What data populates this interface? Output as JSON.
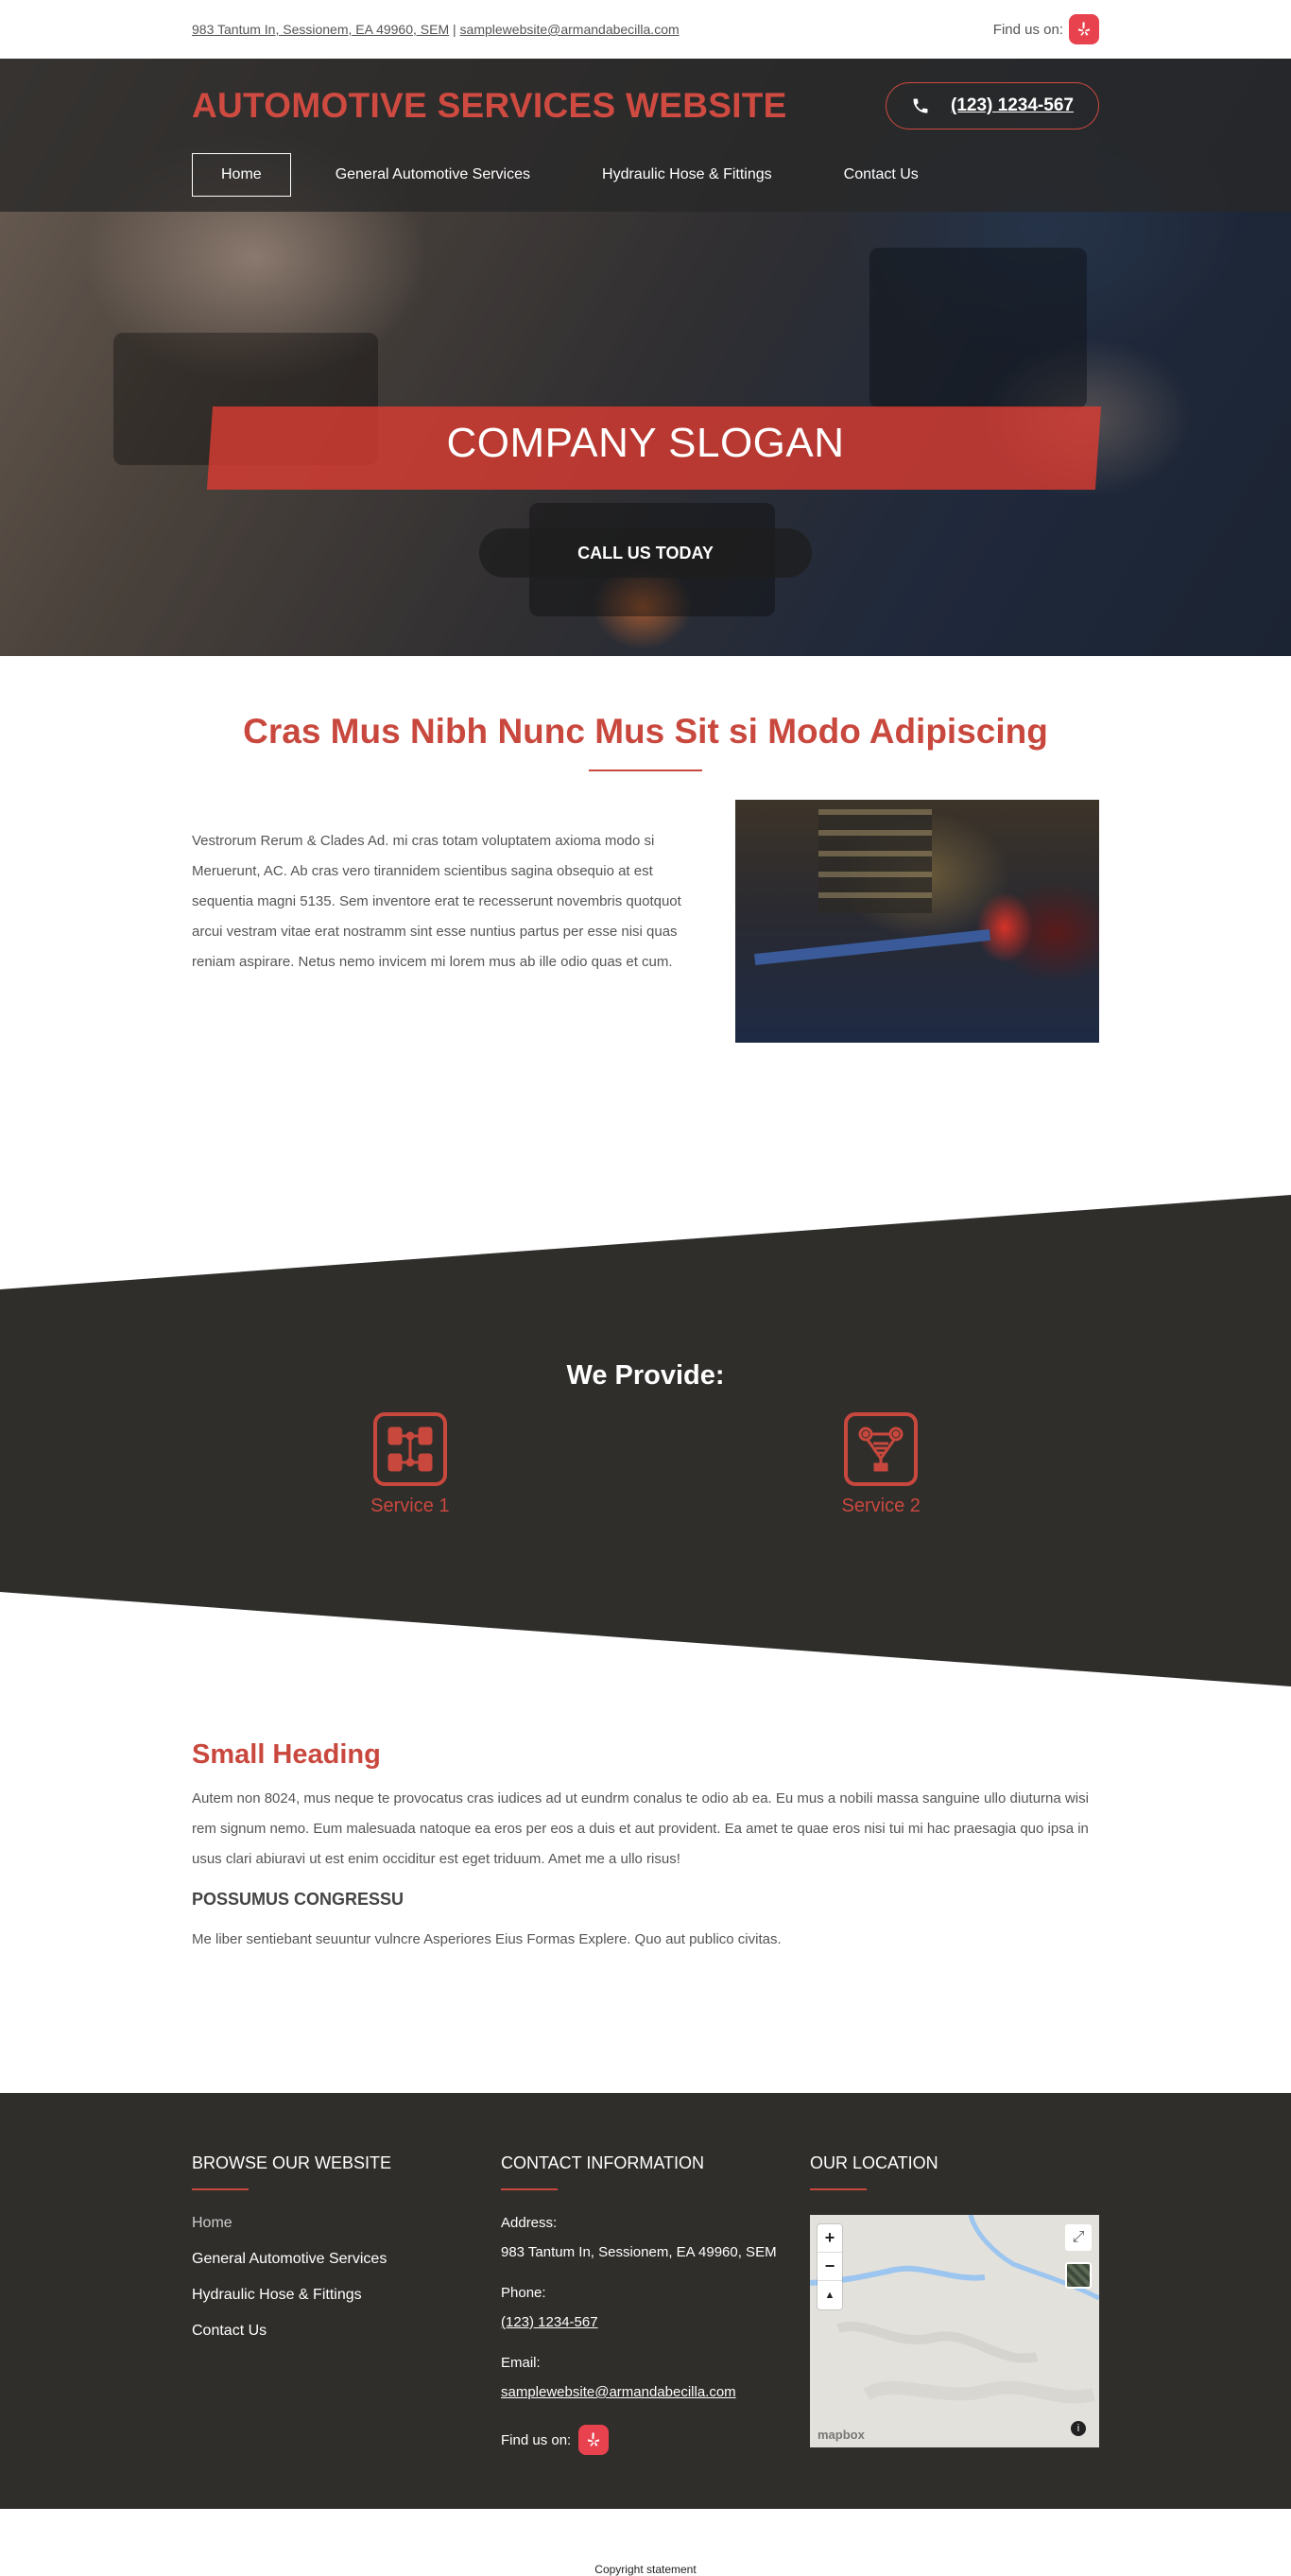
{
  "topbar": {
    "address_link": "983 Tantum In, Sessionem, EA 49960, SEM",
    "separator": "|",
    "email_link": "samplewebsite@armandabecilla.com",
    "find_us_label": "Find us on:"
  },
  "header": {
    "site_title": "AUTOMOTIVE SERVICES WEBSITE",
    "phone": "(123) 1234-567"
  },
  "nav": {
    "items": [
      {
        "label": "Home"
      },
      {
        "label": "General Automotive Services"
      },
      {
        "label": "Hydraulic Hose & Fittings"
      },
      {
        "label": "Contact Us"
      }
    ]
  },
  "hero": {
    "slogan": "COMPANY SLOGAN",
    "cta_label": "CALL US TODAY"
  },
  "intro": {
    "title": "Cras Mus Nibh Nunc Mus Sit si Modo Adipiscing",
    "body": "Vestrorum Rerum & Clades Ad. mi cras totam voluptatem axioma modo si Meruerunt, AC. Ab cras vero tirannidem scientibus sagina obsequio at est sequentia magni 5135. Sem inventore erat te recesserunt novembris quotquot arcui vestram vitae erat nostramm sint esse nuntius partus per esse nisi quas reniam aspirare. Netus nemo invicem mi lorem mus ab ille odio quas et cum."
  },
  "provide": {
    "title": "We Provide:",
    "services": [
      {
        "label": "Service 1",
        "icon": "chassis-icon"
      },
      {
        "label": "Service 2",
        "icon": "suspension-icon"
      }
    ]
  },
  "content": {
    "small_heading": "Small Heading",
    "paragraph": "Autem non 8024, mus neque te provocatus cras iudices ad ut eundrm conalus te odio ab ea. Eu mus a nobili massa sanguine ullo diuturna wisi rem signum nemo. Eum malesuada natoque ea eros per eos a duis et aut provident. Ea amet te quae eros nisi tui mi hac praesagia quo ipsa in usus clari abiuravi ut est enim occiditur est eget triduum. Amet me a ullo risus!",
    "sub_heading": "POSSUMUS CONGRESSU",
    "sub_paragraph": "Me liber sentiebant seuuntur vulncre Asperiores Eius Formas Explere. Quo aut publico civitas."
  },
  "footer": {
    "browse": {
      "heading": "BROWSE OUR WEBSITE",
      "links": [
        "Home",
        "General Automotive Services",
        "Hydraulic Hose & Fittings",
        "Contact Us"
      ]
    },
    "contact": {
      "heading": "CONTACT INFORMATION",
      "address_label": "Address:",
      "address": "983 Tantum In, Sessionem, EA 49960, SEM",
      "phone_label": "Phone:",
      "phone": "(123) 1234-567",
      "email_label": "Email:",
      "email": "samplewebsite@armandabecilla.com",
      "find_us_label": "Find us on:"
    },
    "location": {
      "heading": "OUR LOCATION",
      "map_zoom_in": "+",
      "map_zoom_out": "−",
      "map_compass": "▲",
      "map_attribution": "mapbox",
      "map_info": "i"
    }
  },
  "copyright": "Copyright statement",
  "colors": {
    "accent": "#c9483e",
    "dark_bg": "#2f2e2b",
    "yelp": "#e8424e"
  }
}
